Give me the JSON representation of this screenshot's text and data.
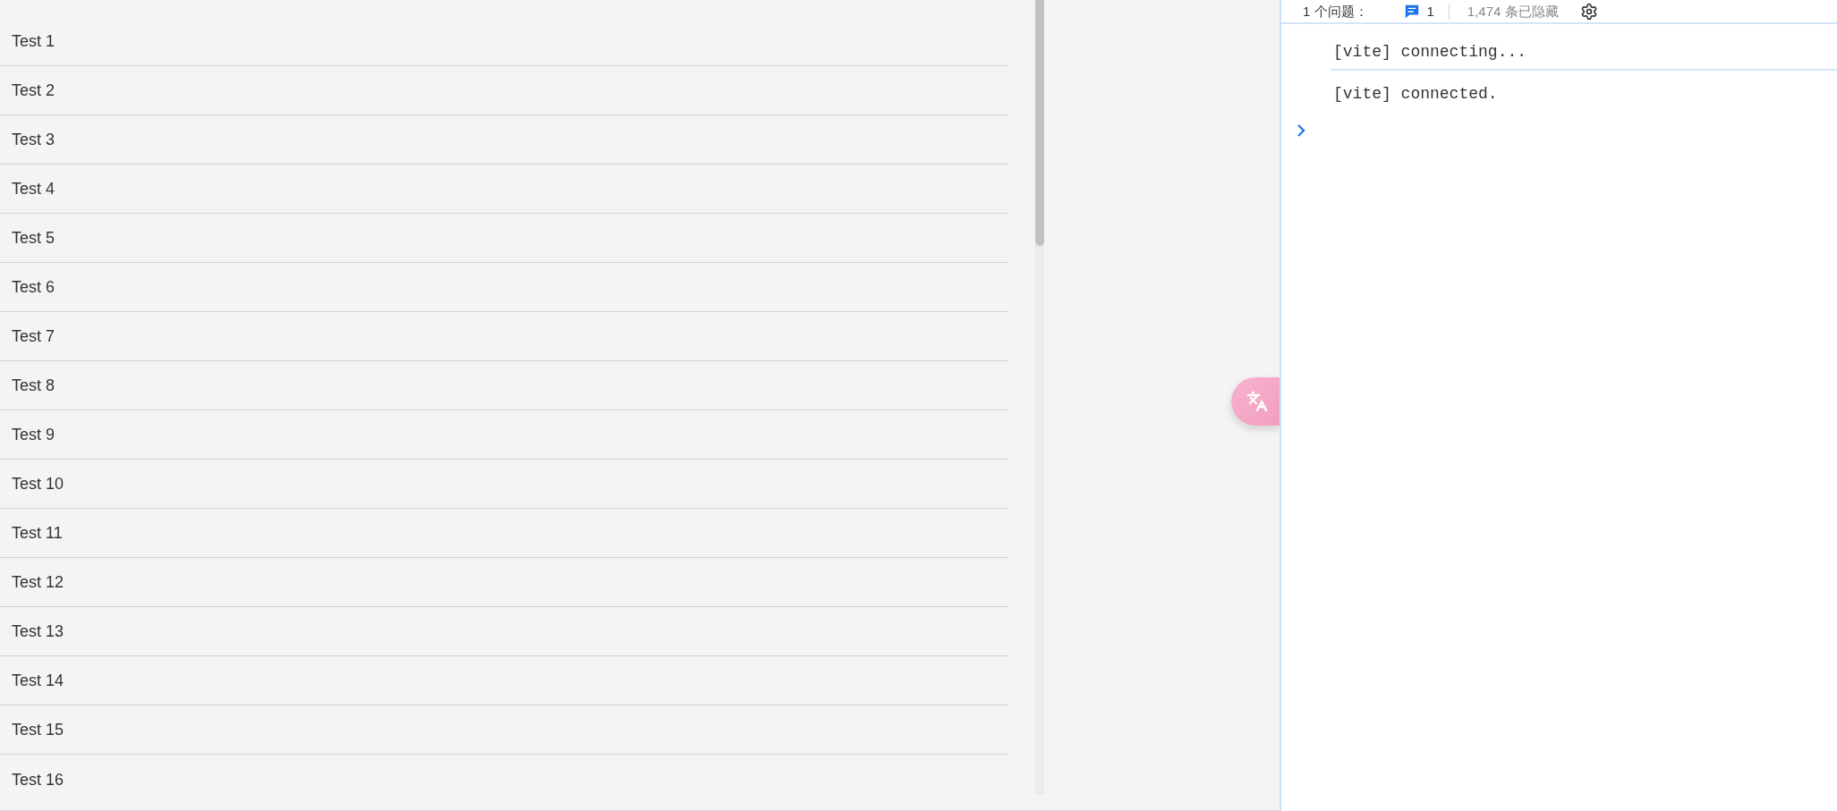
{
  "list": {
    "items": [
      "Test 1",
      "Test 2",
      "Test 3",
      "Test 4",
      "Test 5",
      "Test 6",
      "Test 7",
      "Test 8",
      "Test 9",
      "Test 10",
      "Test 11",
      "Test 12",
      "Test 13",
      "Test 14",
      "Test 15",
      "Test 16"
    ]
  },
  "devtools": {
    "issues_label": "1 个问题：",
    "issue_count": "1",
    "hidden_count": "1,474 条已隐藏",
    "console": {
      "messages": [
        "[vite] connecting...",
        "[vite] connected."
      ]
    }
  }
}
